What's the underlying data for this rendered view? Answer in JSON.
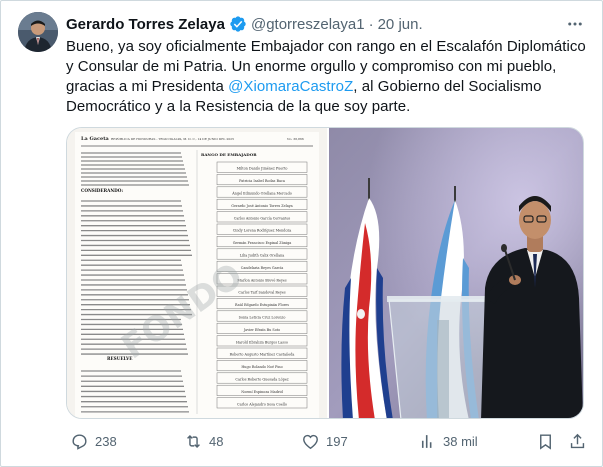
{
  "author": {
    "name": "Gerardo Torres Zelaya",
    "handle": "@gtorreszelaya1",
    "separator": "·",
    "date": "20 jun."
  },
  "tweet": {
    "text_before": "Bueno, ya soy oficialmente Embajador con rango en el Escalafón Diplomático y Consular de mi Patria. Un enorme orgullo y compromiso con mi pueblo, gracias a mi Presidenta ",
    "mention": "@XiomaraCastroZ",
    "text_after": ", al Gobierno del Socialismo Democrático y a la Resistencia de la que soy parte."
  },
  "document": {
    "header_left": "La Gaceta",
    "header_center": "REPÚBLICA DE HONDURAS - TEGUCIGALPA, M. D. C., 14 DE JUNIO DEL 2025",
    "header_right": "No. 36,866",
    "right_heading": "RANGO DE EMBAJADOR",
    "section_considerando": "CONSIDERANDO:",
    "section_resuelve": "RESUELVE",
    "names": [
      "Milton Danilo Jiménez Puerto",
      "Patricia Isabel Rodas Baca",
      "Ángel Edmundo Orellana Mercado",
      "Gerardo José Antonio Torres Zelaya",
      "Carlos Antonio García Cervantes",
      "Cindy Lorena Rodríguez Mendoza",
      "Germán Francisco Espinal Zúniga",
      "Lilia Judith Calix Orellana",
      "Candelaria Reyes García",
      "Marlon Antonio Brevé Reyes",
      "Carlos Tarf Sandoval Reyes",
      "Raúl Edgardo Estupinán Flores",
      "Sonia Leticia Cruz Lorenzo",
      "Javier Efraín Bu Soto",
      "Harold Ebrahim Burgos Lasso",
      "Roberto Augusto Martínez Castañeda",
      "Hugo Rolando Noé Pino",
      "Carlos Roberto Quesada López",
      "Noemí Espinoza Madrid",
      "Carlos Alejandro Sosa Coello"
    ]
  },
  "actions": {
    "replies": "238",
    "retweets": "48",
    "likes": "197",
    "views": "38 mil"
  },
  "colors": {
    "accent": "#1d9bf0",
    "text": "#0f1419",
    "muted": "#536471",
    "border": "#cfd9de"
  },
  "icons": {
    "verified": "verified-badge-icon",
    "more": "more-options-icon",
    "reply": "reply-icon",
    "retweet": "retweet-icon",
    "like": "heart-icon",
    "views": "views-bar-icon",
    "bookmark": "bookmark-icon",
    "share": "share-icon"
  }
}
